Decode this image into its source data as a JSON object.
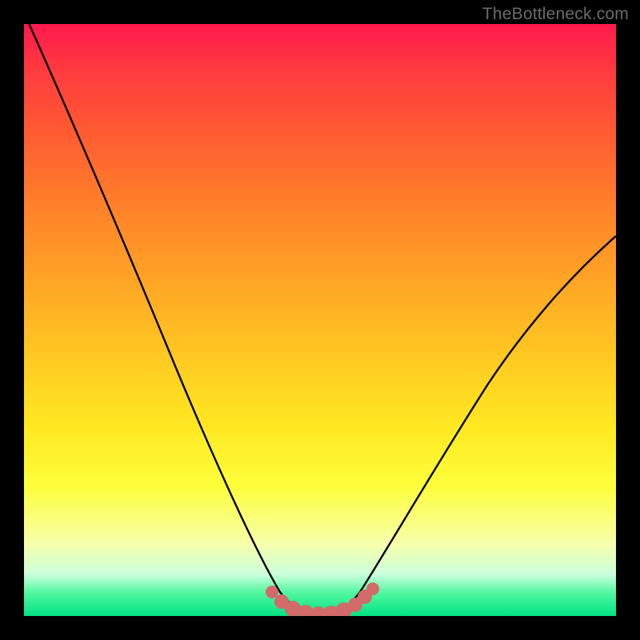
{
  "watermark": {
    "text": "TheBottleneck.com"
  },
  "chart_data": {
    "type": "line",
    "title": "",
    "xlabel": "",
    "ylabel": "",
    "xlim": [
      0,
      100
    ],
    "ylim": [
      0,
      100
    ],
    "series": [
      {
        "name": "bottleneck-curve",
        "x": [
          0,
          6,
          12,
          18,
          24,
          30,
          36,
          40,
          43,
          46,
          48,
          50,
          52,
          54,
          56,
          60,
          66,
          74,
          84,
          94,
          100
        ],
        "y": [
          100,
          88,
          75,
          62,
          48,
          34,
          20,
          10,
          4,
          1,
          0,
          0,
          0,
          1,
          3,
          8,
          16,
          27,
          41,
          55,
          63
        ]
      }
    ],
    "markers": {
      "name": "trough-markers",
      "color": "#d96a6a",
      "points": [
        {
          "x": 42,
          "y": 4
        },
        {
          "x": 44,
          "y": 2
        },
        {
          "x": 46,
          "y": 0.8
        },
        {
          "x": 48,
          "y": 0.3
        },
        {
          "x": 50,
          "y": 0.2
        },
        {
          "x": 52,
          "y": 0.3
        },
        {
          "x": 54,
          "y": 0.8
        },
        {
          "x": 56,
          "y": 2
        },
        {
          "x": 58,
          "y": 4
        }
      ]
    },
    "background": {
      "type": "vertical-gradient",
      "stops": [
        {
          "pos": 0,
          "color": "#ff1a4d"
        },
        {
          "pos": 50,
          "color": "#ffc522"
        },
        {
          "pos": 90,
          "color": "#f6ffad"
        },
        {
          "pos": 100,
          "color": "#00e383"
        }
      ]
    }
  }
}
